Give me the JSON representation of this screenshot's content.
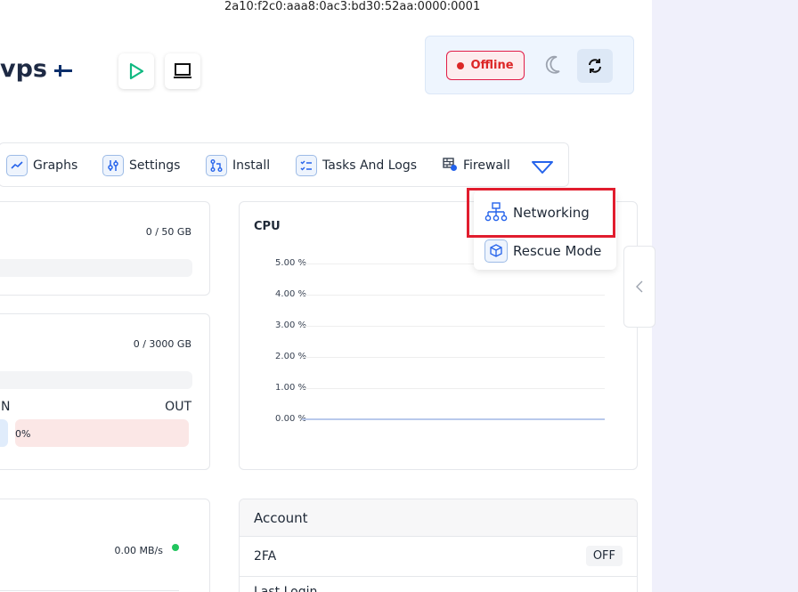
{
  "server": {
    "ipv6": "2a10:f2c0:aaa8:0ac3:bd30:52aa:0000:0001",
    "title": "vps"
  },
  "header": {
    "status_label": "Offline",
    "status_color": "#dc2626"
  },
  "tabs": [
    {
      "label": "Graphs",
      "icon": "graph-icon"
    },
    {
      "label": "Settings",
      "icon": "sliders-icon"
    },
    {
      "label": "Install",
      "icon": "install-icon"
    },
    {
      "label": "Tasks And Logs",
      "icon": "tasks-icon"
    },
    {
      "label": "Firewall",
      "icon": "firewall-icon"
    }
  ],
  "dropdown": {
    "items": [
      {
        "label": "Networking",
        "icon": "network-icon"
      },
      {
        "label": "Rescue Mode",
        "icon": "rescue-icon"
      }
    ]
  },
  "disk": {
    "usage": "0 / 50 GB"
  },
  "bandwidth": {
    "usage": "0 / 3000 GB",
    "in_label": "N",
    "out_label": "OUT",
    "out_percent": "0%"
  },
  "network_speed": {
    "value": "0.00 MB/s",
    "status_color": "#22c55e"
  },
  "cpu": {
    "title": "CPU",
    "yticks": [
      "5.00 %",
      "4.00 %",
      "3.00 %",
      "2.00 %",
      "1.00 %",
      "0.00 %"
    ]
  },
  "chart_data": {
    "type": "line",
    "title": "CPU",
    "ylim": [
      0,
      5
    ],
    "yticks": [
      "5.00 %",
      "4.00 %",
      "3.00 %",
      "2.00 %",
      "1.00 %",
      "0.00 %"
    ],
    "series": [
      {
        "values": [
          0,
          0
        ]
      }
    ]
  },
  "account": {
    "title": "Account",
    "rows": [
      {
        "label": "2FA",
        "value": "OFF"
      },
      {
        "label": "Last Login",
        "value": ""
      }
    ]
  }
}
